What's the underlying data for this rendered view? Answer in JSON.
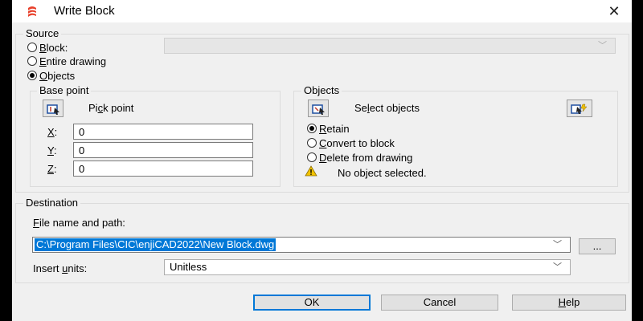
{
  "window": {
    "title": "Write Block",
    "close_glyph": "✕",
    "app_icon": "enjicad-app-icon"
  },
  "source": {
    "title": "Source",
    "block_radio": "Block:",
    "entire_drawing_radio": "Entire drawing",
    "objects_radio": "Objects",
    "selected": "Objects",
    "block_select_value": ""
  },
  "base_point": {
    "title": "Base point",
    "pick_point_label": "Pick point",
    "x_label": "X:",
    "y_label": "Y:",
    "z_label": "Z:",
    "x_value": "0",
    "y_value": "0",
    "z_value": "0"
  },
  "objects": {
    "title": "Objects",
    "select_objects_label": "Select objects",
    "retain_radio": "Retain",
    "convert_radio": "Convert to block",
    "delete_radio": "Delete from drawing",
    "selected": "Retain",
    "warning_text": "No object selected."
  },
  "destination": {
    "title": "Destination",
    "file_label": "File name and path:",
    "file_path": "C:\\Program Files\\CIC\\enjiCAD2022\\New Block.dwg",
    "browse_label": "...",
    "units_label": "Insert units:",
    "units_value": "Unitless"
  },
  "buttons": {
    "ok": "OK",
    "cancel": "Cancel",
    "help": "Help"
  },
  "colors": {
    "accent": "#0078d7",
    "app_icon": "#e8412c",
    "warning": "#f2c200"
  }
}
